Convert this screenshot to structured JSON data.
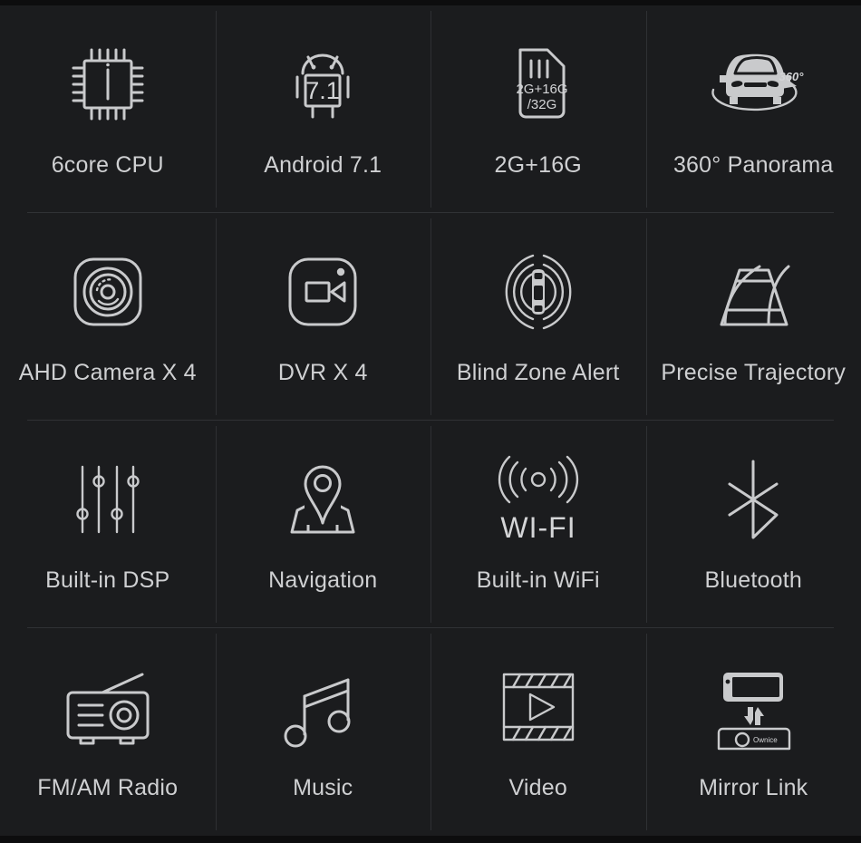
{
  "page": {
    "background_color": "#1b1c1e",
    "label_color": "#cfd0d2",
    "icon_color": "#c9cacc",
    "divider_color": "#2e3033"
  },
  "features": [
    {
      "id": "cpu",
      "icon": "cpu-chip-icon",
      "label": "6core CPU"
    },
    {
      "id": "android",
      "icon": "android-robot-icon",
      "label": "Android 7.1",
      "icon_text": "7.1"
    },
    {
      "id": "memory",
      "icon": "memory-card-icon",
      "label": "2G+16G",
      "icon_text_line1": "2G+16G",
      "icon_text_line2": "/32G"
    },
    {
      "id": "panorama",
      "icon": "car-360-icon",
      "label": "360° Panorama",
      "icon_text": "360°"
    },
    {
      "id": "ahd-camera",
      "icon": "camera-lens-icon",
      "label": "AHD Camera X 4"
    },
    {
      "id": "dvr",
      "icon": "video-camera-icon",
      "label": "DVR X 4"
    },
    {
      "id": "blind-zone",
      "icon": "blind-zone-radar-icon",
      "label": "Blind Zone Alert"
    },
    {
      "id": "trajectory",
      "icon": "parking-guideline-icon",
      "label": "Precise Trajectory"
    },
    {
      "id": "dsp",
      "icon": "equalizer-sliders-icon",
      "label": "Built-in DSP"
    },
    {
      "id": "navigation",
      "icon": "map-pin-icon",
      "label": "Navigation"
    },
    {
      "id": "wifi",
      "icon": "wifi-signal-icon",
      "label": "Built-in WiFi",
      "icon_text": "WI-FI"
    },
    {
      "id": "bluetooth",
      "icon": "bluetooth-icon",
      "label": "Bluetooth"
    },
    {
      "id": "radio",
      "icon": "radio-icon",
      "label": "FM/AM Radio"
    },
    {
      "id": "music",
      "icon": "music-note-icon",
      "label": "Music"
    },
    {
      "id": "video",
      "icon": "film-play-icon",
      "label": "Video"
    },
    {
      "id": "mirror-link",
      "icon": "phone-to-screen-icon",
      "label": "Mirror Link",
      "icon_text": "Ownice"
    }
  ]
}
